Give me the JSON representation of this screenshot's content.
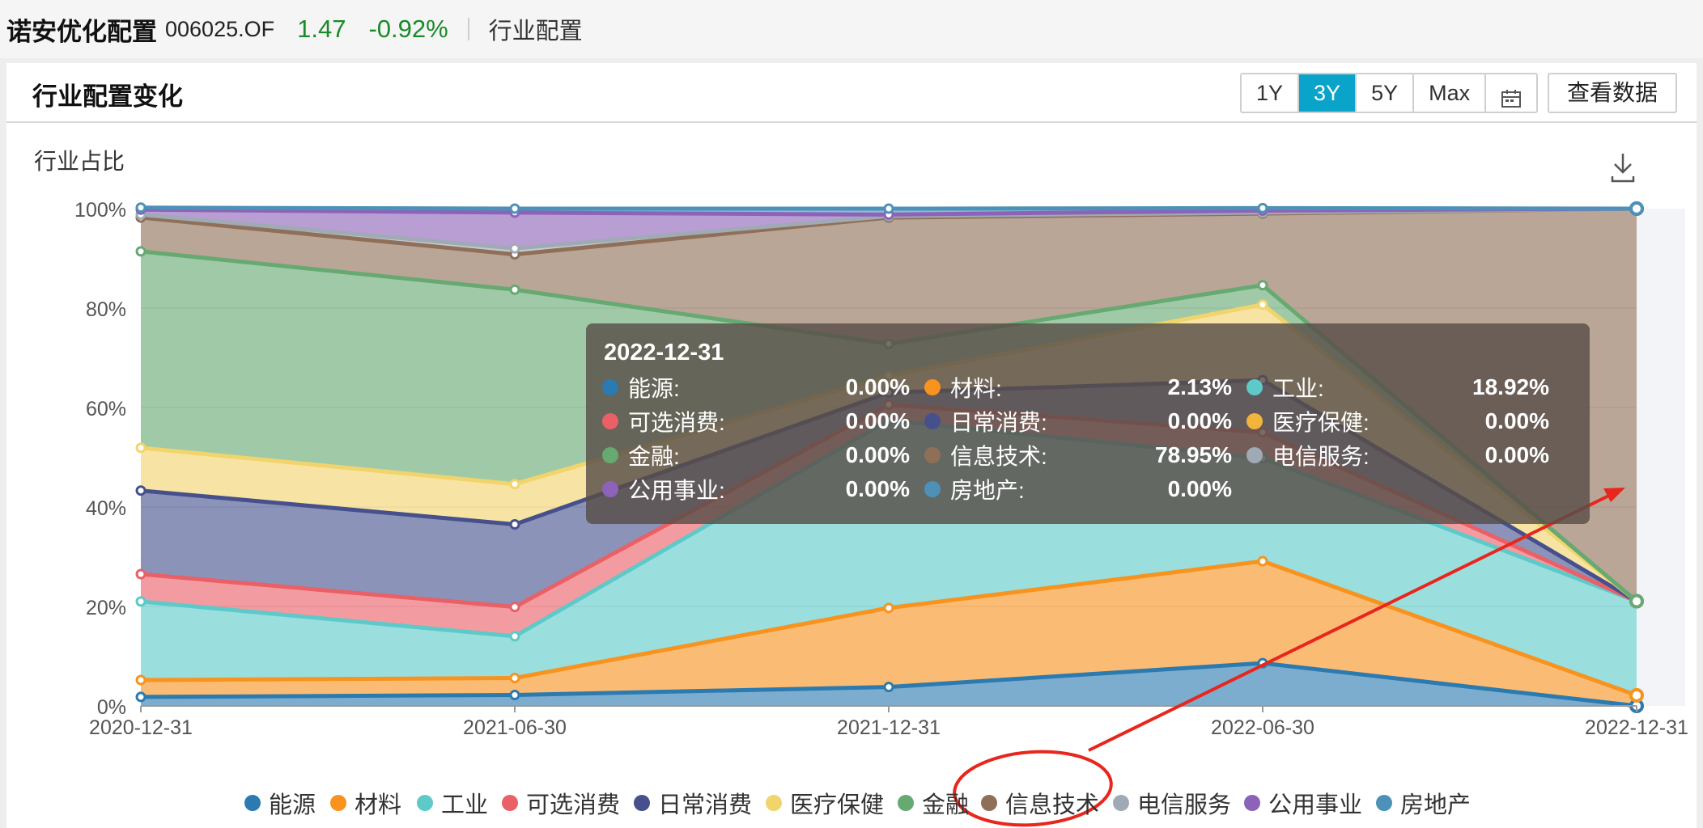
{
  "header": {
    "fund_name": "诺安优化配置",
    "fund_code": "006025.OF",
    "nav": "1.47",
    "change": "-0.92%",
    "breadcrumb": "行业配置"
  },
  "card": {
    "title": "行业配置变化",
    "ranges": [
      "1Y",
      "3Y",
      "5Y",
      "Max"
    ],
    "active_range": "3Y",
    "view_data_label": "查看数据"
  },
  "chart_data": {
    "type": "area",
    "stacked": true,
    "ylabel": "行业占比",
    "ylim": [
      0,
      100
    ],
    "y_ticks": [
      "0%",
      "20%",
      "40%",
      "60%",
      "80%",
      "100%"
    ],
    "categories": [
      "2020-12-31",
      "2021-06-30",
      "2021-12-31",
      "2022-06-30",
      "2022-12-31"
    ],
    "series": [
      {
        "name": "能源",
        "color": "#2b7ab0",
        "values": [
          1.8,
          2.2,
          3.8,
          8.6,
          0.0
        ]
      },
      {
        "name": "材料",
        "color": "#f7931e",
        "values": [
          3.4,
          3.4,
          15.9,
          20.5,
          2.13
        ]
      },
      {
        "name": "工业",
        "color": "#5ec9c9",
        "values": [
          15.8,
          8.4,
          37.7,
          20.7,
          18.92
        ]
      },
      {
        "name": "可选消费",
        "color": "#ea6067",
        "values": [
          5.5,
          5.9,
          3.2,
          5.2,
          0.0
        ]
      },
      {
        "name": "日常消费",
        "color": "#46508c",
        "values": [
          16.8,
          16.6,
          2.4,
          10.5,
          0.0
        ]
      },
      {
        "name": "医疗保健",
        "color": "#f2d46c",
        "values": [
          8.6,
          8.1,
          3.4,
          15.2,
          0.0
        ]
      },
      {
        "name": "金融",
        "color": "#66a971",
        "values": [
          39.5,
          39.1,
          6.4,
          3.9,
          0.0
        ]
      },
      {
        "name": "信息技术",
        "color": "#8f6f57",
        "values": [
          6.8,
          7.1,
          25.4,
          14.4,
          78.95
        ]
      },
      {
        "name": "电信服务",
        "color": "#a0aab4",
        "values": [
          0.6,
          1.2,
          0.3,
          0.2,
          0.0
        ]
      },
      {
        "name": "公用事业",
        "color": "#8c63b8",
        "values": [
          1.0,
          7.2,
          0.3,
          0.4,
          0.0
        ]
      },
      {
        "name": "房地产",
        "color": "#4d91b8",
        "values": [
          0.4,
          0.8,
          1.2,
          0.5,
          0.0
        ]
      }
    ],
    "legend_position": "bottom",
    "tooltip": {
      "date": "2022-12-31",
      "items": [
        {
          "name": "能源:",
          "value": "0.00%",
          "color": "#2b7ab0"
        },
        {
          "name": "材料:",
          "value": "2.13%",
          "color": "#f7931e"
        },
        {
          "name": "工业:",
          "value": "18.92%",
          "color": "#5ec9c9"
        },
        {
          "name": "可选消费:",
          "value": "0.00%",
          "color": "#ea6067"
        },
        {
          "name": "日常消费:",
          "value": "0.00%",
          "color": "#46508c"
        },
        {
          "name": "医疗保健:",
          "value": "0.00%",
          "color": "#f2b43c"
        },
        {
          "name": "金融:",
          "value": "0.00%",
          "color": "#66a971"
        },
        {
          "name": "信息技术:",
          "value": "78.95%",
          "color": "#8f6f57"
        },
        {
          "name": "电信服务:",
          "value": "0.00%",
          "color": "#a0aab4"
        },
        {
          "name": "公用事业:",
          "value": "0.00%",
          "color": "#8c63b8"
        },
        {
          "name": "房地产:",
          "value": "0.00%",
          "color": "#4d91b8"
        }
      ]
    }
  },
  "colors": {
    "accent": "#0aa3c9",
    "positive_green": "#1a8a2a",
    "annotation_red": "#e8261c"
  }
}
